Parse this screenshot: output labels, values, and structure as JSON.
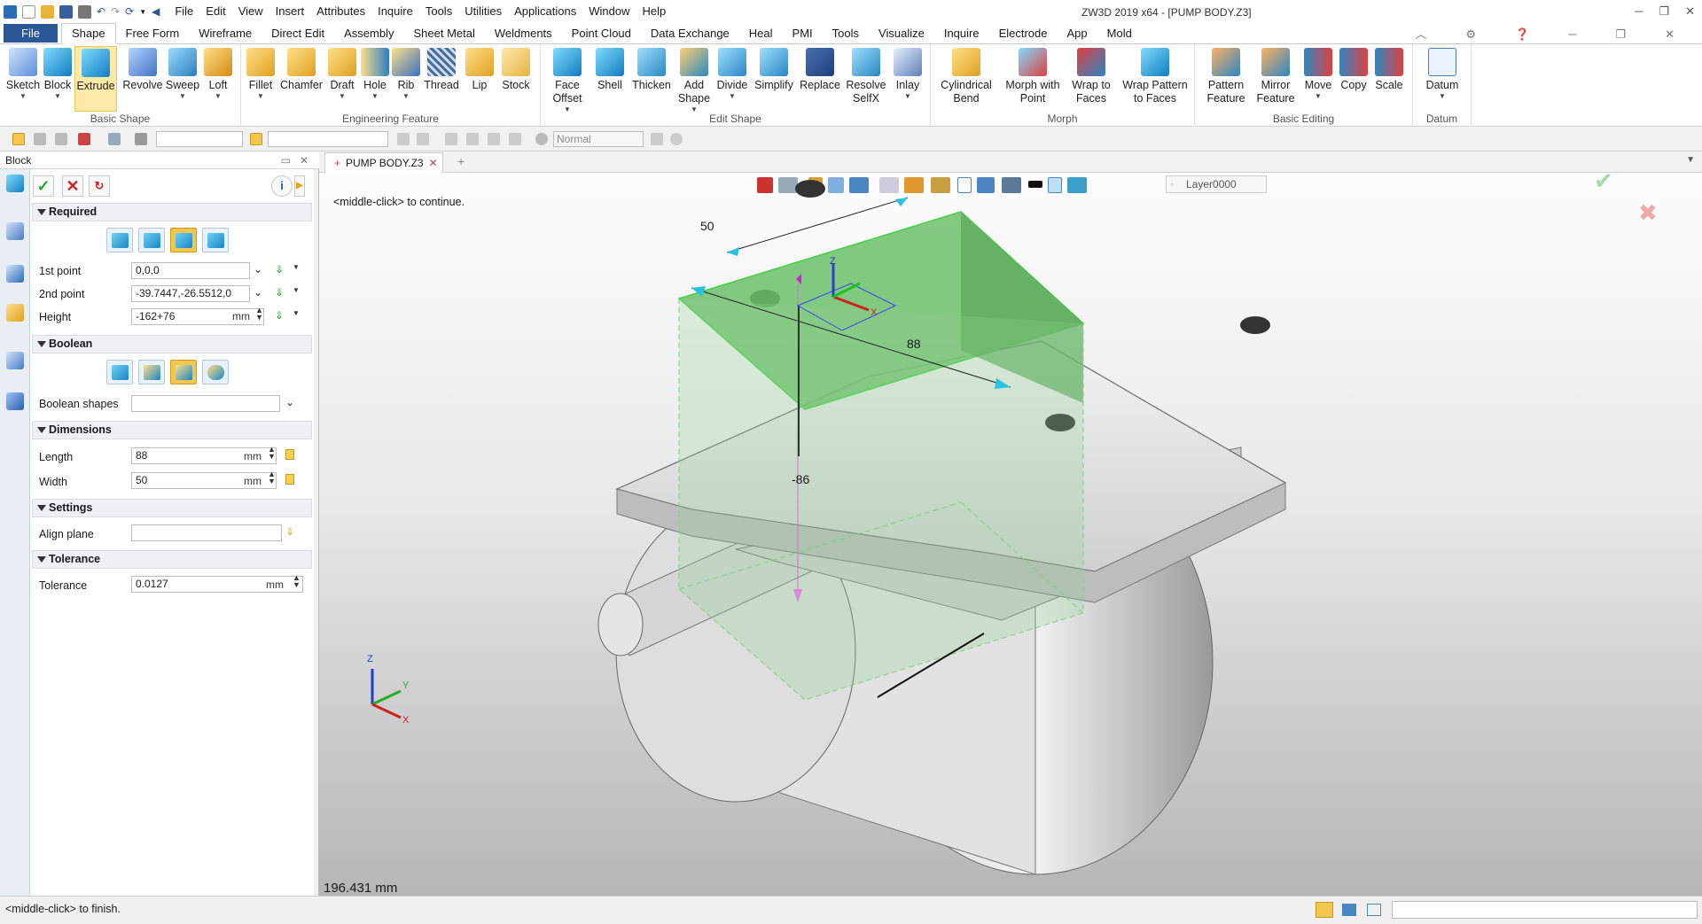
{
  "window": {
    "title": "ZW3D 2019  x64 - [PUMP BODY.Z3]"
  },
  "menu": [
    "File",
    "Edit",
    "View",
    "Insert",
    "Attributes",
    "Inquire",
    "Tools",
    "Utilities",
    "Applications",
    "Window",
    "Help"
  ],
  "ribbon_tabs": [
    "File",
    "Shape",
    "Free Form",
    "Wireframe",
    "Direct Edit",
    "Assembly",
    "Sheet Metal",
    "Weldments",
    "Point Cloud",
    "Data Exchange",
    "Heal",
    "PMI",
    "Tools",
    "Visualize",
    "Inquire",
    "Electrode",
    "App",
    "Mold"
  ],
  "ribbon_groups": [
    {
      "name": "Basic Shape",
      "buttons": [
        {
          "label": "Sketch"
        },
        {
          "label": "Block"
        },
        {
          "label": "Extrude"
        },
        {
          "label": "Revolve"
        },
        {
          "label": "Sweep"
        },
        {
          "label": "Loft"
        }
      ]
    },
    {
      "name": "Engineering Feature",
      "buttons": [
        {
          "label": "Fillet"
        },
        {
          "label": "Chamfer"
        },
        {
          "label": "Draft"
        },
        {
          "label": "Hole"
        },
        {
          "label": "Rib"
        },
        {
          "label": "Thread"
        },
        {
          "label": "Lip"
        },
        {
          "label": "Stock"
        }
      ]
    },
    {
      "name": "Edit Shape",
      "buttons": [
        {
          "label": "Face Offset"
        },
        {
          "label": "Shell"
        },
        {
          "label": "Thicken"
        },
        {
          "label": "Add Shape"
        },
        {
          "label": "Divide"
        },
        {
          "label": "Simplify"
        },
        {
          "label": "Replace"
        },
        {
          "label": "Resolve SelfX"
        },
        {
          "label": "Inlay"
        }
      ]
    },
    {
      "name": "Morph",
      "buttons": [
        {
          "label": "Cylindrical Bend"
        },
        {
          "label": "Morph with Point"
        },
        {
          "label": "Wrap to Faces"
        },
        {
          "label": "Wrap Pattern to Faces"
        }
      ]
    },
    {
      "name": "Basic Editing",
      "buttons": [
        {
          "label": "Pattern Feature"
        },
        {
          "label": "Mirror Feature"
        },
        {
          "label": "Move"
        },
        {
          "label": "Copy"
        },
        {
          "label": "Scale"
        }
      ]
    },
    {
      "name": "Datum",
      "buttons": [
        {
          "label": "Datum"
        }
      ]
    }
  ],
  "toolbar2": {
    "render_mode": "Normal"
  },
  "document_tab": {
    "name": "PUMP BODY.Z3"
  },
  "panel": {
    "title": "Block",
    "sections": {
      "required": "Required",
      "boolean": "Boolean",
      "dimensions": "Dimensions",
      "settings": "Settings",
      "tolerance": "Tolerance"
    },
    "first_point": {
      "label": "1st point",
      "value": "0,0,0"
    },
    "second_point": {
      "label": "2nd point",
      "value": "-39.7447,-26.5512,0"
    },
    "height": {
      "label": "Height",
      "value": "-162+76",
      "unit": "mm"
    },
    "boolean_shapes": {
      "label": "Boolean shapes",
      "value": ""
    },
    "length": {
      "label": "Length",
      "value": "88",
      "unit": "mm"
    },
    "width": {
      "label": "Width",
      "value": "50",
      "unit": "mm"
    },
    "align_plane": {
      "label": "Align plane",
      "value": ""
    },
    "tolerance": {
      "label": "Tolerance",
      "value": "0.0127",
      "unit": "mm"
    }
  },
  "viewport": {
    "hint": "<middle-click> to continue.",
    "layer": "Layer0000",
    "dim_width": "50",
    "dim_length": "88",
    "dim_height": "-86",
    "measure": "196.431 mm",
    "axis_labels": {
      "x": "X",
      "y": "Y",
      "z": "Z"
    }
  },
  "status": {
    "text": "<middle-click> to finish."
  }
}
